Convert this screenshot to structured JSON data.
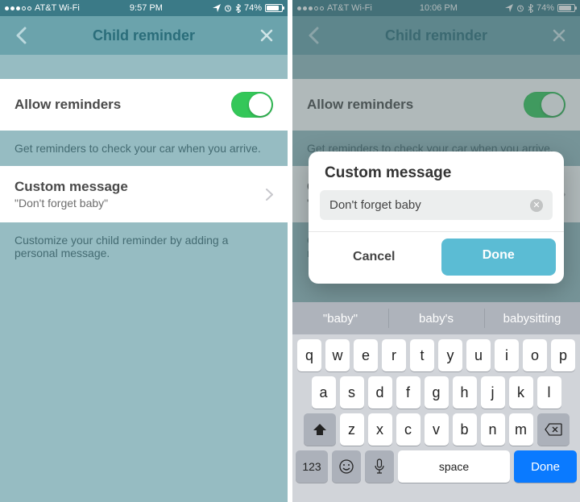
{
  "left": {
    "status": {
      "carrier": "AT&T Wi-Fi",
      "time": "9:57 PM",
      "battery_pct": "74%",
      "signal_dots": 5,
      "signal_filled": 3
    },
    "nav": {
      "title": "Child reminder"
    },
    "allow": {
      "label": "Allow reminders",
      "on": true
    },
    "hint1": "Get reminders to check your car when you arrive.",
    "custom": {
      "title": "Custom message",
      "value": "\"Don't forget baby\""
    },
    "hint2": "Customize your child reminder by adding a personal message."
  },
  "right": {
    "status": {
      "carrier": "AT&T Wi-Fi",
      "time": "10:06 PM",
      "battery_pct": "74%",
      "signal_dots": 5,
      "signal_filled": 3
    },
    "nav": {
      "title": "Child reminder"
    },
    "allow": {
      "label": "Allow reminders",
      "on": true
    },
    "hint1": "Get reminders to check your car when you arrive.",
    "custom": {
      "title": "Cu",
      "value": "\"Dc"
    },
    "hint2_a": "Cu",
    "hint2_b": "me",
    "modal": {
      "title": "Custom message",
      "input": "Don't forget baby",
      "cancel": "Cancel",
      "done": "Done"
    },
    "suggestions": [
      "\"baby\"",
      "baby's",
      "babysitting"
    ],
    "keyboard": {
      "row1": [
        "q",
        "w",
        "e",
        "r",
        "t",
        "y",
        "u",
        "i",
        "o",
        "p"
      ],
      "row2": [
        "a",
        "s",
        "d",
        "f",
        "g",
        "h",
        "j",
        "k",
        "l"
      ],
      "row3": [
        "z",
        "x",
        "c",
        "v",
        "b",
        "n",
        "m"
      ],
      "sym": "123",
      "space": "space",
      "return": "Done"
    }
  }
}
